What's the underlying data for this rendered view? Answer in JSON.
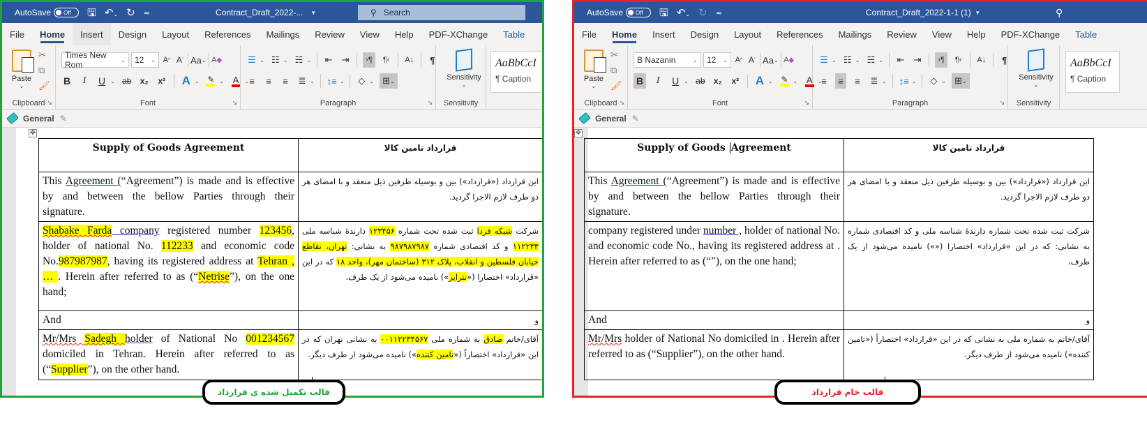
{
  "left_window": {
    "frame_color": "#22a33a",
    "titlebar": {
      "autosave_label": "AutoSave",
      "autosave_state": "Off",
      "doc_title": "Contract_Draft_2022-...",
      "search_placeholder": "Search"
    },
    "tabs": [
      "File",
      "Home",
      "Insert",
      "Design",
      "Layout",
      "References",
      "Mailings",
      "Review",
      "View",
      "Help",
      "PDF-XChange",
      "Table"
    ],
    "active_tab": "Home",
    "ribbon": {
      "clipboard_label": "Clipboard",
      "paste_label": "Paste",
      "font_group_label": "Font",
      "font_name": "Times New Rom",
      "font_size": "12",
      "change_case_label": "Aa",
      "paragraph_group_label": "Paragraph",
      "sensitivity_button_label": "Sensitivity",
      "sensitivity_group_label": "Sensitivity",
      "style_sample": "AaBbCcI",
      "style_name": "¶ Caption",
      "bold_label": "B",
      "italic_label": "I",
      "underline_label": "U",
      "strike_label": "ab",
      "subscript_label": "x₂",
      "superscript_label": "x²"
    },
    "sensitivity_tag": "General",
    "document": {
      "title_en": "Supply of Goods Agreement",
      "title_fa": "قرارداد تامین کالا",
      "intro_en_pre": "This ",
      "intro_en_link": "Agreement (",
      "intro_en_post": "“Agreement”) is made and is effective by and between the bellow Parties through their signature.",
      "intro_fa": "این قرارداد («قرارداد») بین و بوسیله طرفین ذیل منعقد و با امضای هر دو طرف لازم الاجرا گردید.",
      "party1_en": {
        "company_name": "Shabake Farda",
        "company_word": " company",
        "t1": " registered number ",
        "reg_number": "123456",
        "t2": ", holder of national No. ",
        "national_no": "112233",
        "t3": " and economic code No.",
        "economic_code": "987987987",
        "t4": ", having its registered address at ",
        "address": "Tehran , … ",
        "t5": ". Herein after referred to as (“",
        "alias": "Netrise",
        "t6": "”), on the one hand;"
      },
      "party1_fa": {
        "t0": "شرکت ",
        "company_name": "شبکه فردا",
        "t1": " ثبت شده تحت شماره ",
        "reg_number": "۱۲۳۴۵۶",
        "t2": " دارندهٔ شناسه ملی ",
        "national_no": "۱۱۲۲۳۳",
        "t3": " و کد اقتصادی شماره ",
        "economic_code": "۹۸۷۹۸۷۹۸۷",
        "t4": " به نشانی: ",
        "address": "تهران، تقاطع خیابان فلسطین و انقلاب، پلاک ۳۱۲ (ساختمان مهر)، واحد ۱۸",
        "t5": " که در این «قرارداد» اختصارا («",
        "alias": "نترایز",
        "t6": "») نامیده می‌شود از یک طرف."
      },
      "and_en": "And",
      "and_fa": "و",
      "party2_en": {
        "t0": "Mr/Mrs ",
        "name": "Sadegh ",
        "t1": " ",
        "holder": "holder",
        "t2": " of National No ",
        "national_no": "001234567",
        "t3": " domiciled in   Tehran. Herein after referred to as (“",
        "alias": "Supplier",
        "t4": "”), on the other hand."
      },
      "party2_fa": {
        "t0": "آقای/خانم ",
        "name": "صادق",
        "t1": " به شماره ملی ",
        "national_no": "۰۰۱۱۲۲۳۴۵۶۷",
        "t2": " به نشانی تهران که در این «قرارداد» اختصاراً («",
        "alias": "تامین کننده",
        "t3": "») نامیده می‌شود از طرف دیگر."
      }
    },
    "callout_label": "قالب تکمیل شده ی قرارداد"
  },
  "right_window": {
    "frame_color": "#e8202a",
    "titlebar": {
      "autosave_label": "AutoSave",
      "autosave_state": "Off",
      "doc_title": "Contract_Draft_2022-1-1 (1)"
    },
    "tabs": [
      "File",
      "Home",
      "Insert",
      "Design",
      "Layout",
      "References",
      "Mailings",
      "Review",
      "View",
      "Help",
      "PDF-XChange",
      "Table"
    ],
    "active_tab": "Home",
    "ribbon": {
      "clipboard_label": "Clipboard",
      "paste_label": "Paste",
      "font_group_label": "Font",
      "font_name": "B Nazanin",
      "font_size": "12",
      "change_case_label": "Aa",
      "paragraph_group_label": "Paragraph",
      "sensitivity_button_label": "Sensitivity",
      "sensitivity_group_label": "Sensitivity",
      "style_sample": "AaBbCcI",
      "style_name": "¶ Caption",
      "bold_label": "B",
      "italic_label": "I",
      "underline_label": "U",
      "strike_label": "ab",
      "subscript_label": "x₂",
      "superscript_label": "x²"
    },
    "sensitivity_tag": "General",
    "document": {
      "title_en_a": "Supply of Goods ",
      "title_en_b": "Agreement",
      "title_fa": "قرارداد تامین کالا",
      "intro_en_pre": "This ",
      "intro_en_link": "Agreement (",
      "intro_en_post": "“Agreement”) is made and is effective by and between the bellow Parties through their signature.",
      "intro_fa": "این قرارداد («قرارداد») بین و بوسیله طرفین ذیل منعقد و با امضای هر دو طرف لازم الاجرا گردید.",
      "party1_en_a": "  company registered under ",
      "party1_en_link": "number ,",
      "party1_en_b": " holder of national No. and economic code No., having its registered address at . Herein after referred to as (“”), on the one hand;",
      "party1_fa": "شرکت  ثبت شده تحت شماره  دارندهٔ شناسه ملی  و کد اقتصادی شماره  به نشانی:  که در این «قرارداد» اختصارا («») نامیده می‌شود از یک طرف،",
      "and_en": "And",
      "and_fa": "و",
      "party2_en_a": "Mr/Mrs",
      "party2_en_b": " holder of National No  domiciled in   . Herein after referred to as (“Supplier”), on the other hand.",
      "party2_fa": "آقای/خانم  به شماره ملی  به نشانی که در این «قرارداد» اختصاراً («تامین کننده») نامیده می‌شود از طرف دیگر."
    },
    "callout_label": "قالب خام قرارداد"
  }
}
